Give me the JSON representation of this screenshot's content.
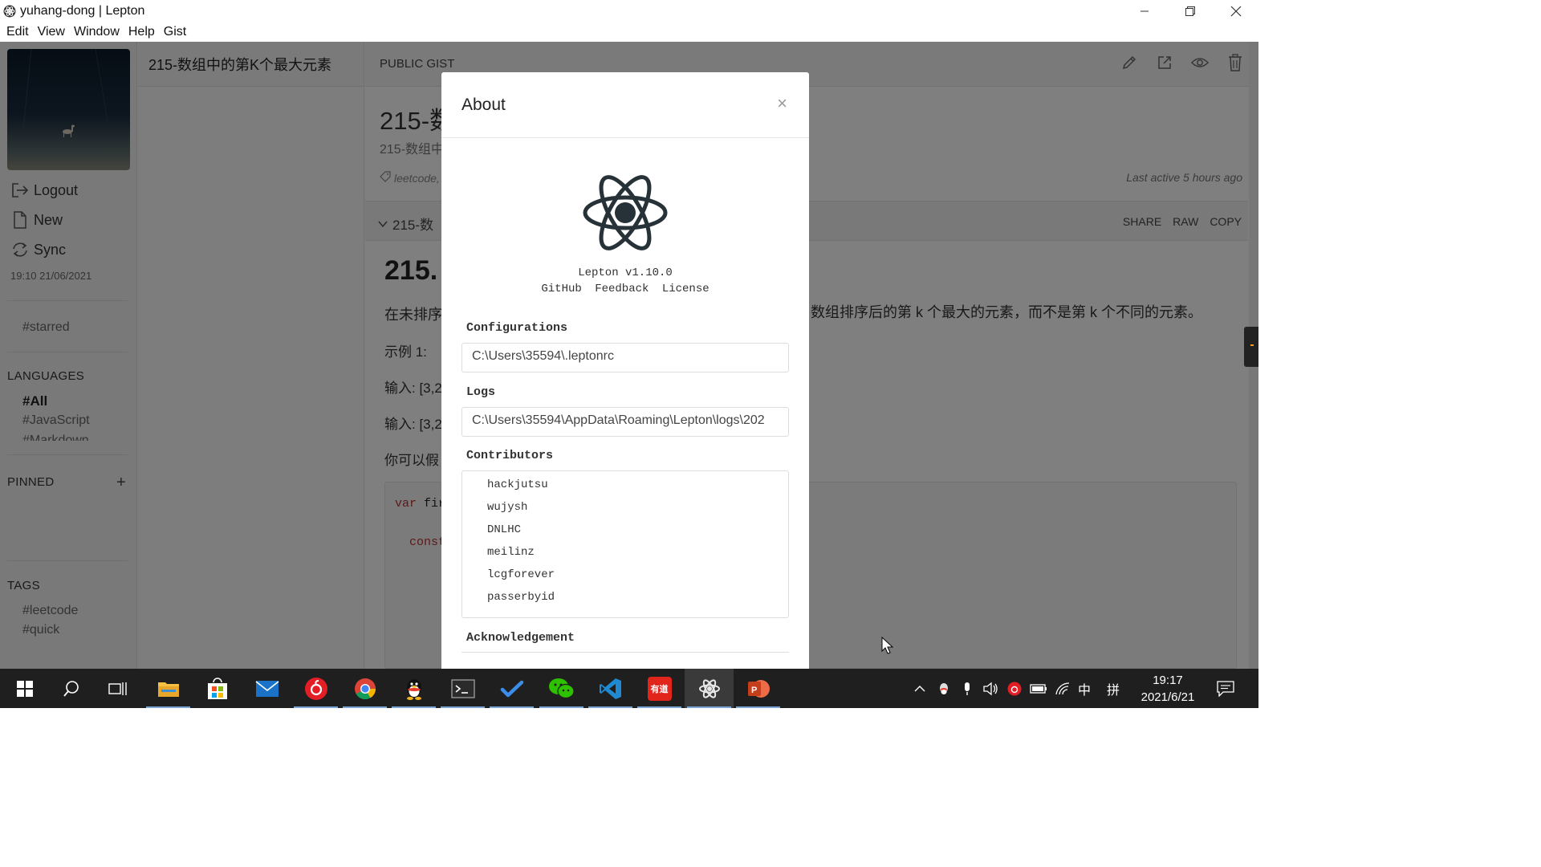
{
  "window": {
    "title": "yuhang-dong | Lepton",
    "controls": [
      "minimize",
      "restore",
      "close"
    ]
  },
  "menu": [
    "Edit",
    "View",
    "Window",
    "Help",
    "Gist"
  ],
  "sidebar": {
    "actions": [
      {
        "label": "Logout",
        "icon": "logout-icon"
      },
      {
        "label": "New",
        "icon": "file-icon"
      },
      {
        "label": "Sync",
        "icon": "sync-icon"
      }
    ],
    "sync_time": "19:10 21/06/2021",
    "starred": "#starred",
    "languages_title": "LANGUAGES",
    "languages": [
      "#All",
      "#JavaScript",
      "#Markdown"
    ],
    "pinned_title": "PINNED",
    "tags_title": "TAGS",
    "tags": [
      "#leetcode",
      "#quick"
    ]
  },
  "gist_list": {
    "selected_title": "215-数组中的第K个最大元素"
  },
  "main": {
    "visibility": "PUBLIC GIST",
    "title": "215-数",
    "subtitle": "215-数组中",
    "tag": "leetcode,",
    "last_active": "Last active 5 hours ago",
    "file_name": "215-数",
    "file_actions": [
      "SHARE",
      "RAW",
      "COPY"
    ],
    "heading": "215.",
    "para1_left": "在未排序",
    "para1_right": "数组排序后的第 k 个最大的元素，而不是第 k 个不同的元素。",
    "example": "示例 1:",
    "input1": "输入: [3,2",
    "input2": "输入: [3,2",
    "assume": "你可以假",
    "code_kw": "var",
    "code_rest": "fir",
    "code_line2": "const"
  },
  "about": {
    "title": "About",
    "close": "×",
    "version": "Lepton v1.10.0",
    "links": [
      "GitHub",
      "Feedback",
      "License"
    ],
    "config_label": "Configurations",
    "config_path": "C:\\Users\\35594\\.leptonrc",
    "logs_label": "Logs",
    "logs_path": "C:\\Users\\35594\\AppData\\Roaming\\Lepton\\logs\\202",
    "contributors_label": "Contributors",
    "contributors": [
      "hackjutsu",
      "wujysh",
      "DNLHC",
      "meilinz",
      "lcgforever",
      "passerbyid"
    ],
    "acknowledgement_label": "Acknowledgement"
  },
  "taskbar": {
    "apps": [
      "start-icon",
      "search-icon",
      "task-view-icon",
      "file-explorer-icon",
      "store-icon",
      "mail-icon",
      "netease-music-icon",
      "chrome-icon",
      "qq-icon",
      "terminal-icon",
      "todo-icon",
      "wechat-icon",
      "vscode-icon",
      "youdao-icon",
      "lepton-icon",
      "powerpoint-icon"
    ],
    "youdao_label": "有道",
    "ime_lang": "中",
    "ime_mode": "拼",
    "time": "19:17",
    "date": "2021/6/21"
  },
  "colors": {
    "taskbar": "#1f1f1f",
    "overlay": "rgba(0,0,0,0.5)",
    "modal_bg": "#ffffff"
  }
}
